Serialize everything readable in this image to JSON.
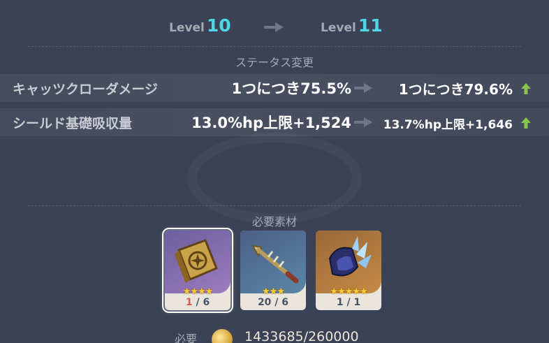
{
  "level": {
    "word": "Level",
    "from": "10",
    "to": "11"
  },
  "status_section": {
    "title": "ステータス変更",
    "rows": [
      {
        "name": "キャッツクローダメージ",
        "old": "1つにつき75.5%",
        "new": "1つにつき79.6%"
      },
      {
        "name": "シールド基礎吸収量",
        "old": "13.0%hp上限+1,524",
        "new": "13.7%hp上限+1,646"
      }
    ]
  },
  "materials_section": {
    "title": "必要素材",
    "items": [
      {
        "icon": "talent-book-icon",
        "rarity": 4,
        "stars": "★★★★",
        "have": "1",
        "need": "6",
        "sufficient": false
      },
      {
        "icon": "arrowhead-material-icon",
        "rarity": 3,
        "stars": "★★★",
        "have": "20",
        "need": "6",
        "sufficient": true
      },
      {
        "icon": "crown-fragment-icon",
        "rarity": 5,
        "stars": "★★★★★",
        "have": "1",
        "need": "1",
        "sufficient": true
      }
    ]
  },
  "cost": {
    "label": "必要",
    "icon": "mora-coin-icon",
    "value": "1433685/260000"
  },
  "colors": {
    "background": "#3b4255",
    "level_accent": "#4fd7e8",
    "increase_arrow": "#8bc34a",
    "insufficient": "#e05a4a"
  }
}
